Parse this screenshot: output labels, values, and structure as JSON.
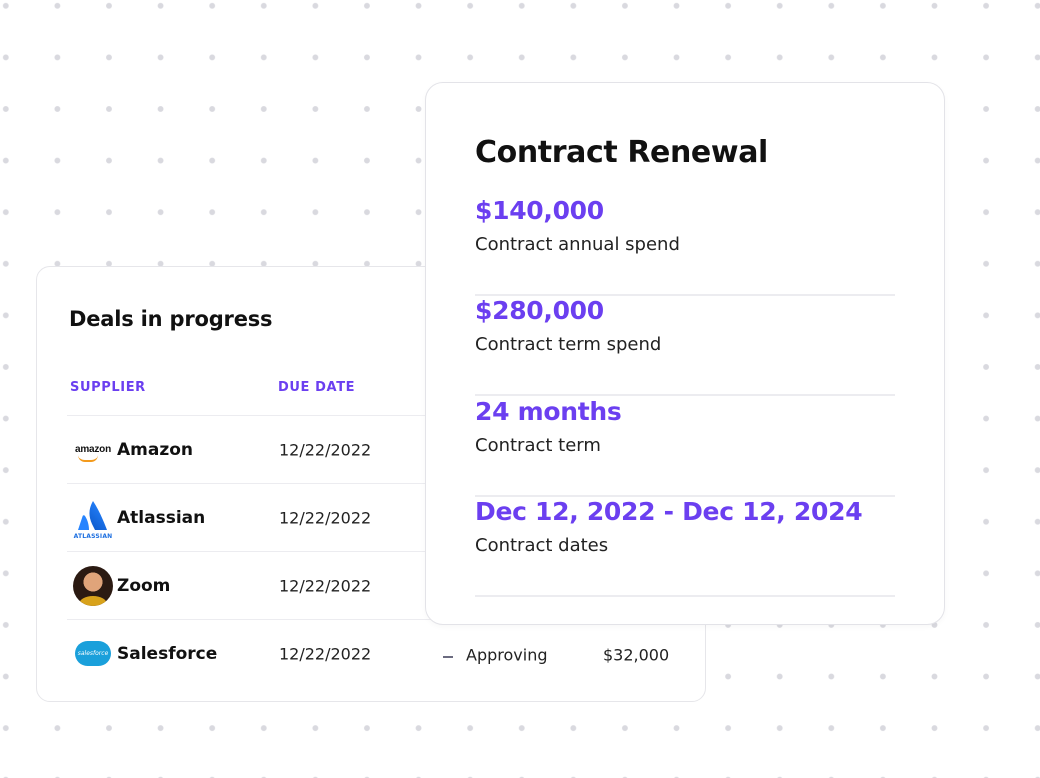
{
  "deals": {
    "title": "Deals in progress",
    "columns": {
      "supplier": "SUPPLIER",
      "due_date": "DUE DATE"
    },
    "rows": [
      {
        "supplier": "Amazon",
        "logo_text": "amazon",
        "due_date": "12/22/2022"
      },
      {
        "supplier": "Atlassian",
        "logo_text": "ATLASSIAN",
        "due_date": "12/22/2022"
      },
      {
        "supplier": "Zoom",
        "due_date": "12/22/2022"
      },
      {
        "supplier": "Salesforce",
        "logo_text": "salesforce",
        "due_date": "12/22/2022",
        "status": "Approving",
        "amount": "$32,000"
      }
    ]
  },
  "contract": {
    "title": "Contract Renewal",
    "metrics": [
      {
        "value": "$140,000",
        "label": "Contract annual spend"
      },
      {
        "value": "$280,000",
        "label": "Contract term spend"
      },
      {
        "value": "24 months",
        "label": "Contract term"
      },
      {
        "value": "Dec 12, 2022 - Dec 12, 2024",
        "label": "Contract dates"
      }
    ]
  },
  "colors": {
    "accent": "#6b3ff0",
    "amazon_orange": "#f39a1c",
    "atlassian_blue": "#1d6fe0",
    "salesforce_blue": "#1aa0db"
  }
}
